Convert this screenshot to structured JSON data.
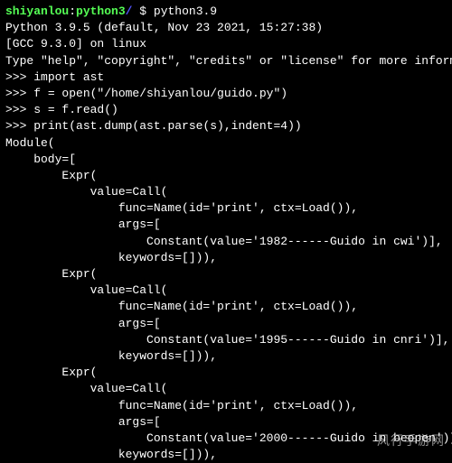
{
  "shell": {
    "user": "shiyanlou",
    "host": "python3",
    "path": "/",
    "symbol": "$",
    "command": "python3.9"
  },
  "banner": {
    "line1": "Python 3.9.5 (default, Nov 23 2021, 15:27:38)",
    "line2": "[GCC 9.3.0] on linux",
    "line3": "Type \"help\", \"copyright\", \"credits\" or \"license\" for more information."
  },
  "repl": {
    "p": ">>> ",
    "l1": "import ast",
    "l2": "f = open(\"/home/shiyanlou/guido.py\")",
    "l3": "s = f.read()",
    "l4": "print(ast.dump(ast.parse(s),indent=4))"
  },
  "ast": {
    "l01": "Module(",
    "l02": "    body=[",
    "l03": "        Expr(",
    "l04": "            value=Call(",
    "l05": "                func=Name(id='print', ctx=Load()),",
    "l06": "                args=[",
    "l07": "                    Constant(value='1982------Guido in cwi')],",
    "l08": "                keywords=[])),",
    "l09": "        Expr(",
    "l10": "            value=Call(",
    "l11": "                func=Name(id='print', ctx=Load()),",
    "l12": "                args=[",
    "l13": "                    Constant(value='1995------Guido in cnri')],",
    "l14": "                keywords=[])),",
    "l15": "        Expr(",
    "l16": "            value=Call(",
    "l17": "                func=Name(id='print', ctx=Load()),",
    "l18": "                args=[",
    "l19": "                    Constant(value='2000------Guido in beopen')],",
    "l20": "                keywords=[])),"
  },
  "watermark": "风行手游网"
}
